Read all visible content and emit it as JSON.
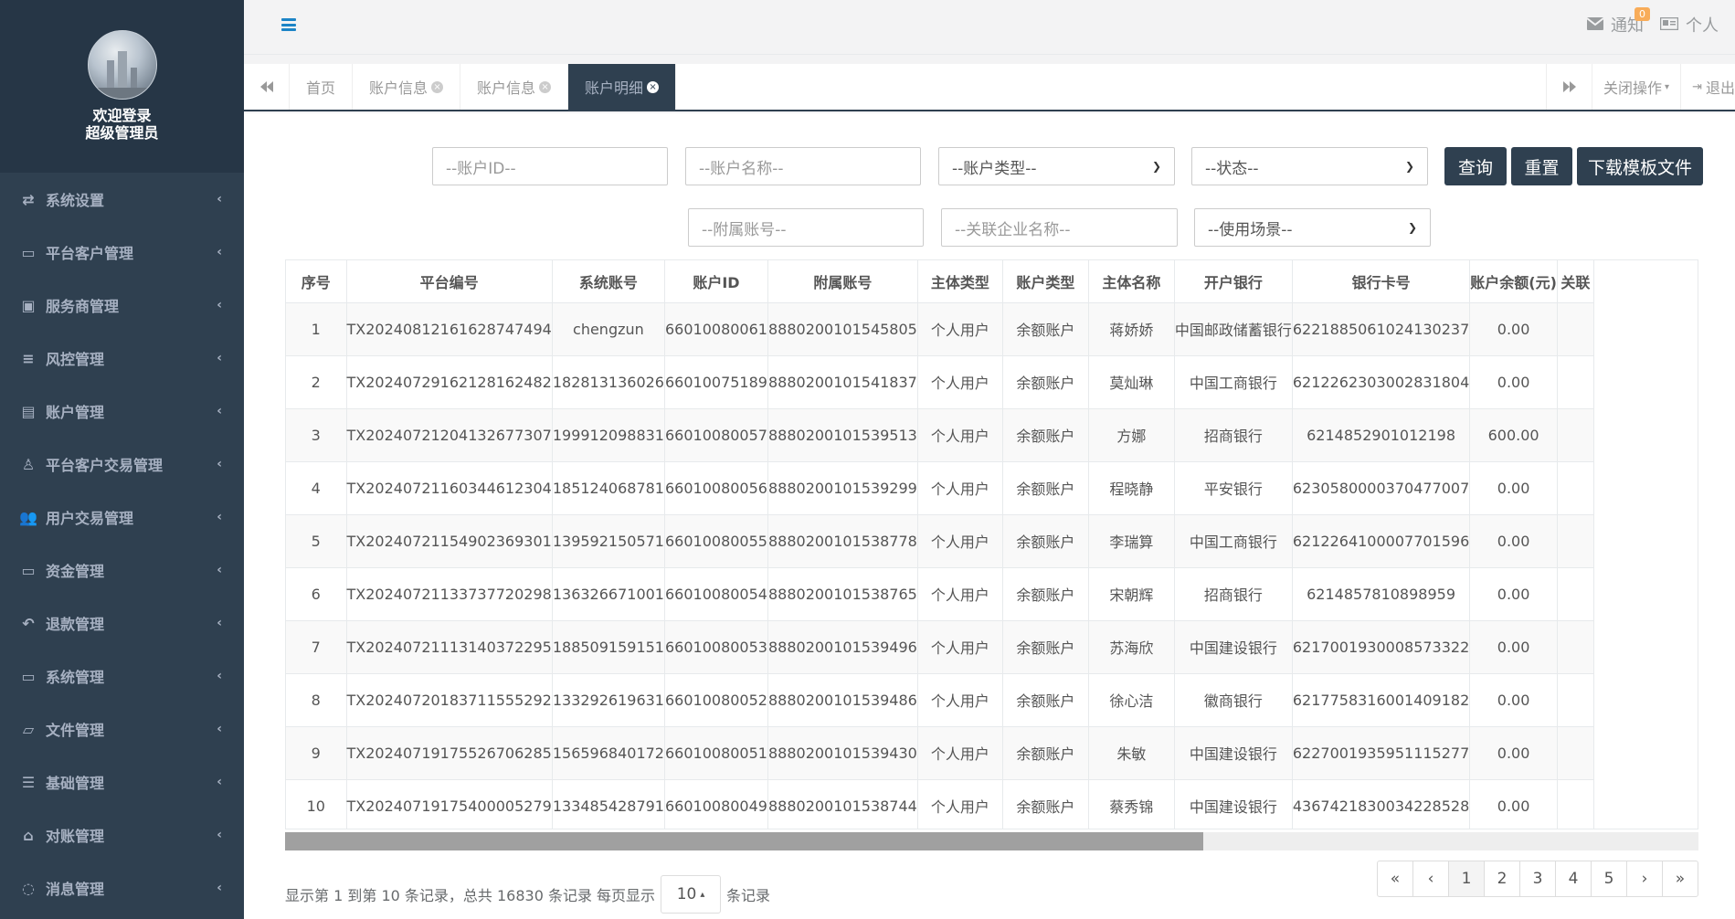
{
  "sidebar": {
    "welcome_line1": "欢迎登录",
    "welcome_line2": "超级管理员",
    "items": [
      {
        "label": "系统设置",
        "icon": "shuffle-icon"
      },
      {
        "label": "平台客户管理",
        "icon": "id-card-icon"
      },
      {
        "label": "服务商管理",
        "icon": "address-book-icon"
      },
      {
        "label": "风控管理",
        "icon": "database-icon"
      },
      {
        "label": "账户管理",
        "icon": "contact-book-icon"
      },
      {
        "label": "平台客户交易管理",
        "icon": "user-icon"
      },
      {
        "label": "用户交易管理",
        "icon": "users-icon"
      },
      {
        "label": "资金管理",
        "icon": "money-icon"
      },
      {
        "label": "退款管理",
        "icon": "reply-icon"
      },
      {
        "label": "系统管理",
        "icon": "desktop-icon"
      },
      {
        "label": "文件管理",
        "icon": "folder-open-icon"
      },
      {
        "label": "基础管理",
        "icon": "bars-icon"
      },
      {
        "label": "对账管理",
        "icon": "bank-icon"
      },
      {
        "label": "消息管理",
        "icon": "comment-icon"
      }
    ]
  },
  "topbar": {
    "notify_label": "通知",
    "notify_count": "0",
    "profile_label": "个人"
  },
  "tabs": {
    "items": [
      "首页",
      "账户信息",
      "账户信息",
      "账户明细"
    ],
    "close_ops": "关闭操作",
    "logout": "退出"
  },
  "filters": {
    "account_id_placeholder": "--账户ID--",
    "account_name_placeholder": "--账户名称--",
    "account_type": "--账户类型--",
    "status": "--状态--",
    "sub_account_placeholder": "--附属账号--",
    "enterprise_placeholder": "--关联企业名称--",
    "scene": "--使用场景--",
    "query_button": "查询",
    "reset_button": "重置",
    "download_button": "下载模板文件"
  },
  "table": {
    "headers": [
      "序号",
      "平台编号",
      "系统账号",
      "账户ID",
      "附属账号",
      "主体类型",
      "账户类型",
      "主体名称",
      "开户银行",
      "银行卡号",
      "账户余额(元)",
      "关联"
    ],
    "rows": [
      [
        "1",
        "TX20240812161628747494",
        "chengzun",
        "66010080061",
        "8880200101545805",
        "个人用户",
        "余额账户",
        "蒋娇娇",
        "中国邮政储蓄银行",
        "6221885061024130237",
        "0.00",
        ""
      ],
      [
        "2",
        "TX20240729162128162482",
        "182813136026",
        "66010075189",
        "8880200101541837",
        "个人用户",
        "余额账户",
        "莫灿琳",
        "中国工商银行",
        "6212262303002831804",
        "0.00",
        ""
      ],
      [
        "3",
        "TX20240721204132677307",
        "199912098831",
        "66010080057",
        "8880200101539513",
        "个人用户",
        "余额账户",
        "方娜",
        "招商银行",
        "6214852901012198",
        "600.00",
        ""
      ],
      [
        "4",
        "TX20240721160344612304",
        "185124068781",
        "66010080056",
        "8880200101539299",
        "个人用户",
        "余额账户",
        "程晓静",
        "平安银行",
        "6230580000370477007",
        "0.00",
        ""
      ],
      [
        "5",
        "TX20240721154902369301",
        "139592150571",
        "66010080055",
        "8880200101538778",
        "个人用户",
        "余额账户",
        "李瑞算",
        "中国工商银行",
        "6212264100007701596",
        "0.00",
        ""
      ],
      [
        "6",
        "TX20240721133737720298",
        "136326671001",
        "66010080054",
        "8880200101538765",
        "个人用户",
        "余额账户",
        "宋朝辉",
        "招商银行",
        "6214857810898959",
        "0.00",
        ""
      ],
      [
        "7",
        "TX20240721113140372295",
        "188509159151",
        "66010080053",
        "8880200101539496",
        "个人用户",
        "余额账户",
        "苏海欣",
        "中国建设银行",
        "6217001930008573322",
        "0.00",
        ""
      ],
      [
        "8",
        "TX20240720183711555292",
        "133292619631",
        "66010080052",
        "8880200101539486",
        "个人用户",
        "余额账户",
        "徐心洁",
        "徽商银行",
        "6217758316001409182",
        "0.00",
        ""
      ],
      [
        "9",
        "TX20240719175526706285",
        "156596840172",
        "66010080051",
        "8880200101539430",
        "个人用户",
        "余额账户",
        "朱敏",
        "中国建设银行",
        "6227001935951115277",
        "0.00",
        ""
      ],
      [
        "10",
        "TX20240719175400005279",
        "133485428791",
        "66010080049",
        "8880200101538744",
        "个人用户",
        "余额账户",
        "蔡秀锦",
        "中国建设银行",
        "4367421830034228528",
        "0.00",
        ""
      ]
    ]
  },
  "pager": {
    "summary": "显示第 1 到第 10 条记录，总共 16830 条记录 每页显示",
    "page_size": "10",
    "suffix": "条记录",
    "buttons": [
      "«",
      "‹",
      "1",
      "2",
      "3",
      "4",
      "5",
      "›",
      "»"
    ],
    "active": "1"
  },
  "colors": {
    "sidebar_bg": "#2f4050",
    "accent": "#2f4050",
    "badge": "#f8ac59"
  }
}
